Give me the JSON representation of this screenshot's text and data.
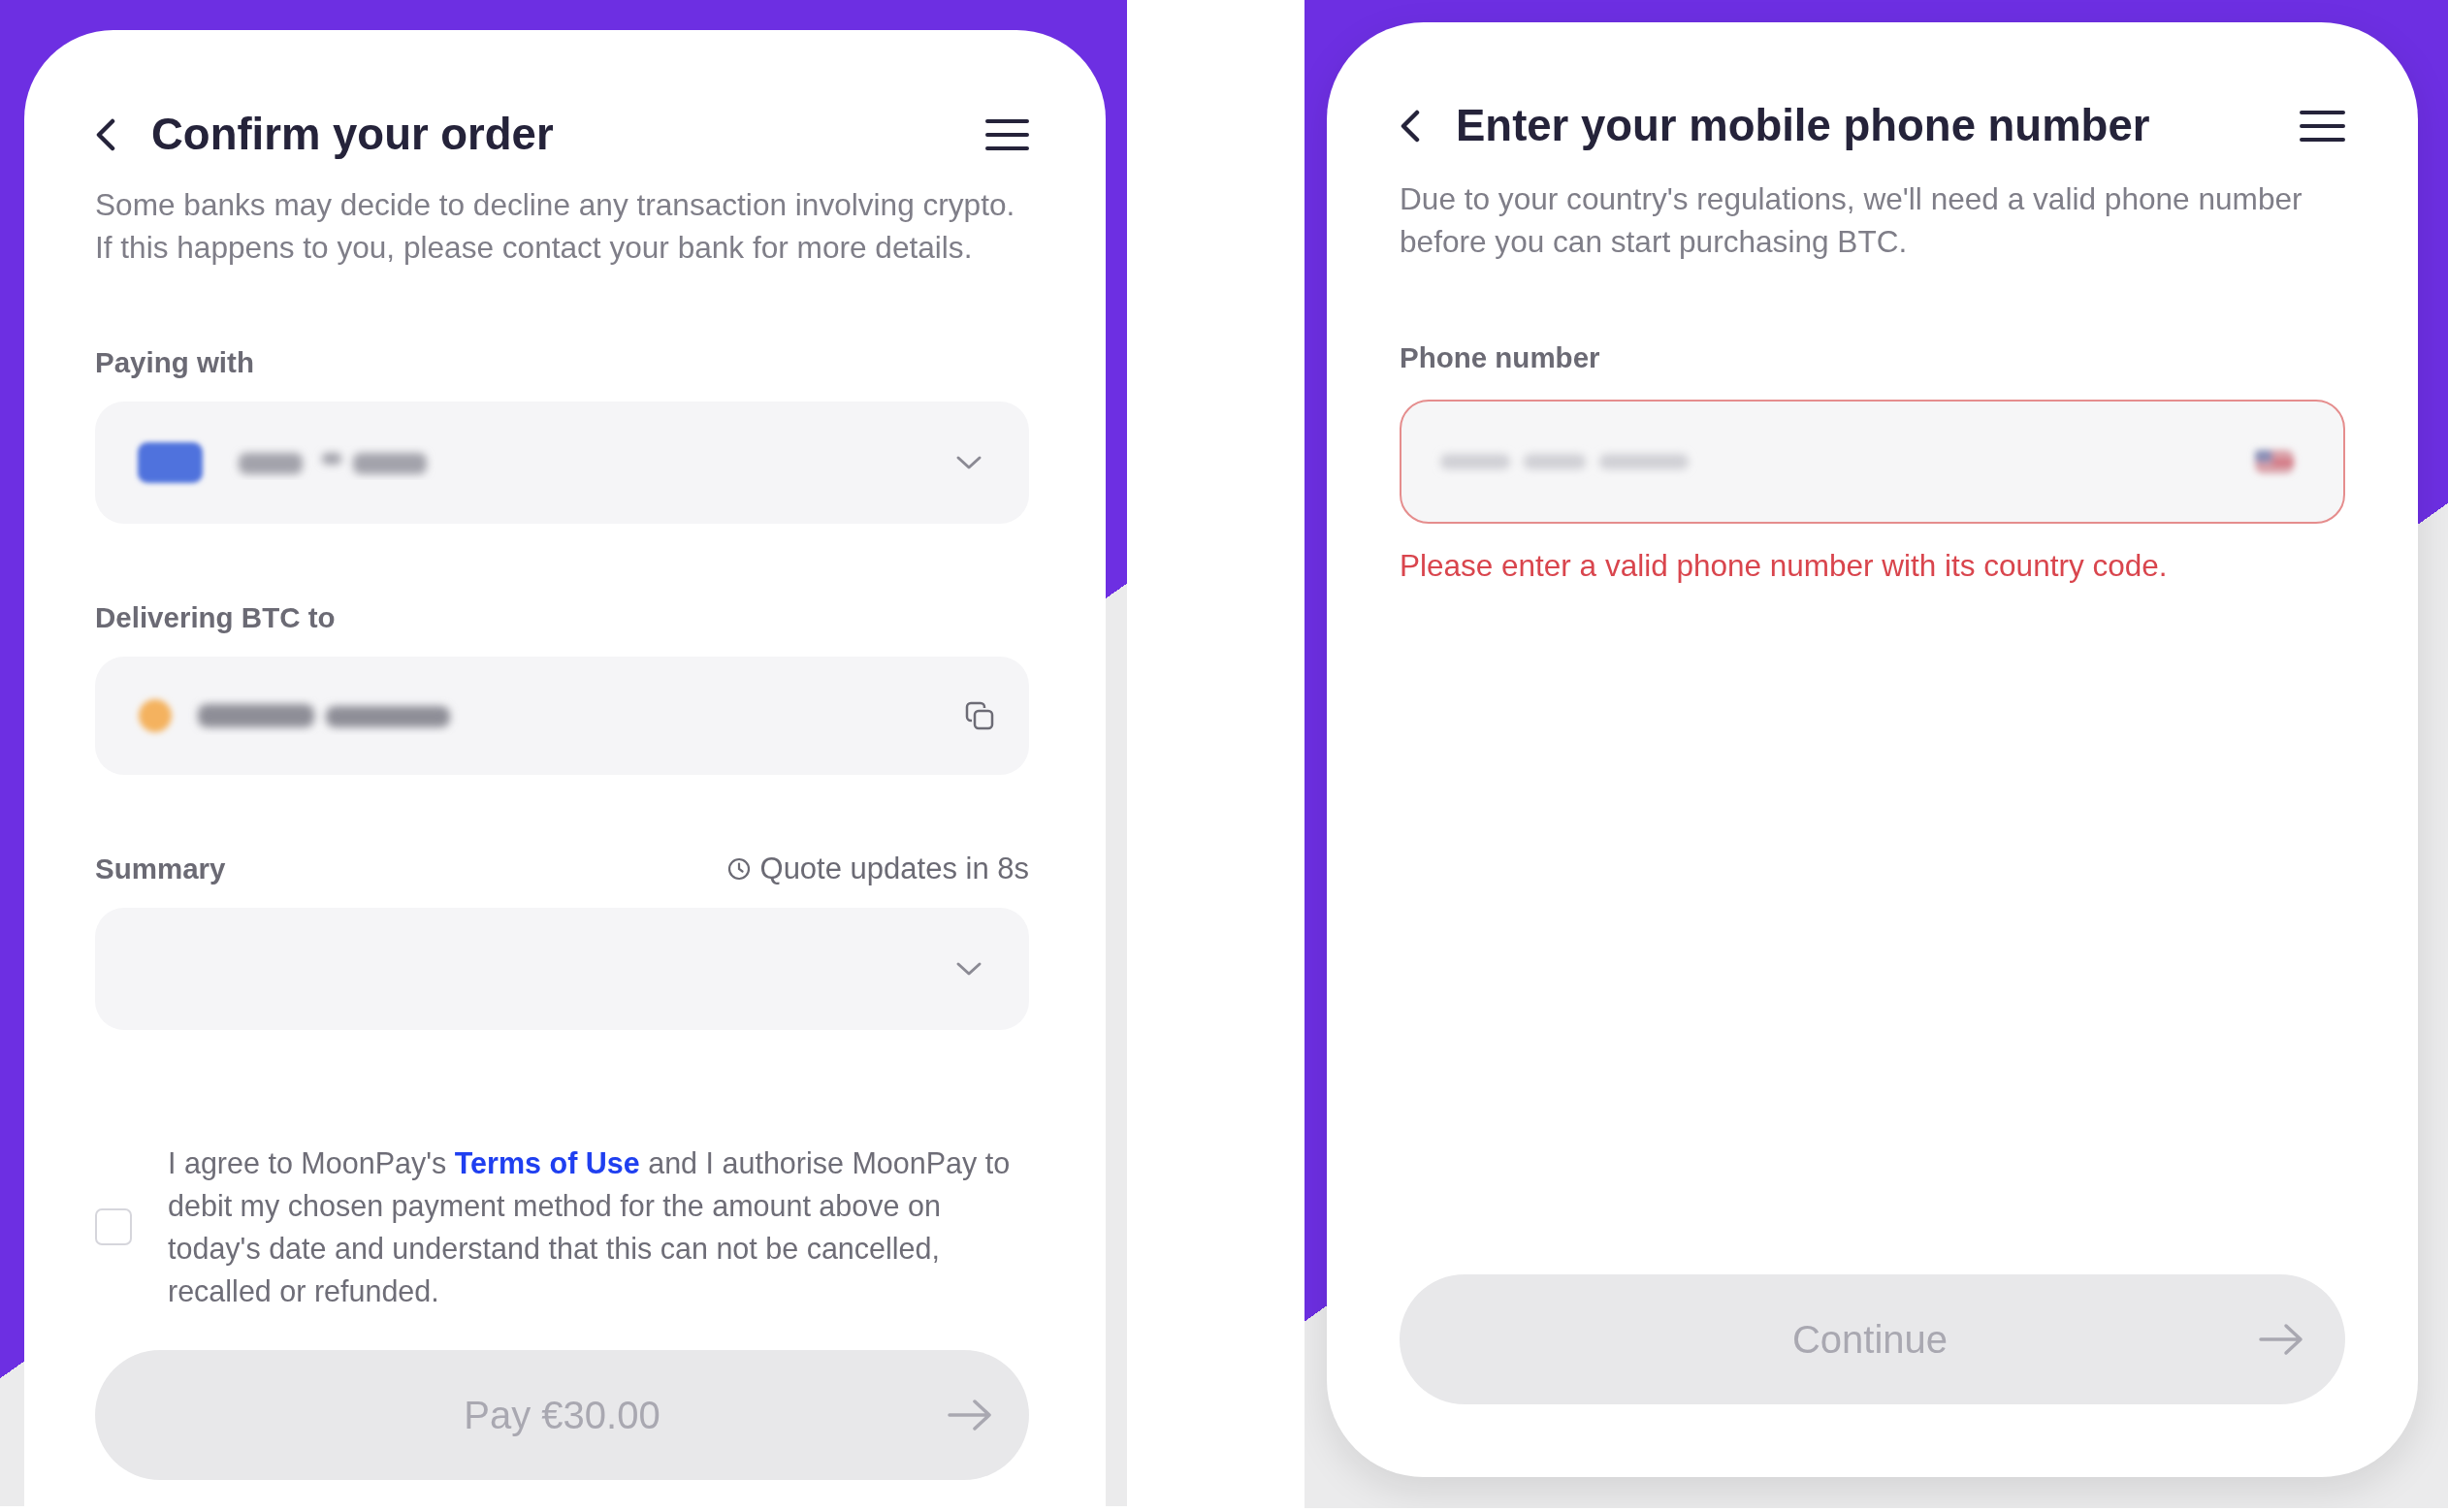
{
  "confirm_order": {
    "title": "Confirm your order",
    "description": "Some banks may decide to decline any transaction involving crypto. If this happens to you, please contact your bank for more details.",
    "fields": [
      {
        "kind": "payment_method",
        "label": "Paying with"
      },
      {
        "kind": "wallet_address",
        "label": "Delivering BTC to"
      },
      {
        "kind": "summary",
        "label": "Summary",
        "note": "Quote updates in 8s"
      }
    ],
    "consent": {
      "checked": false,
      "before": "I agree to MoonPay's ",
      "link": "Terms of Use",
      "after": " and I authorise MoonPay to debit my chosen payment method for the amount above on today's date and understand that this can not be cancelled, recalled or refunded."
    },
    "button": {
      "label": "Pay €30.00",
      "disabled": true
    }
  },
  "phone_number": {
    "title": "Enter your mobile phone number",
    "description": "Due to your country's regulations, we'll need a valid phone number before you can start purchasing BTC.",
    "field": {
      "label": "Phone number",
      "error": true,
      "message": "Please enter a valid phone number with its country code."
    },
    "button": {
      "label": "Continue",
      "disabled": true
    }
  }
}
